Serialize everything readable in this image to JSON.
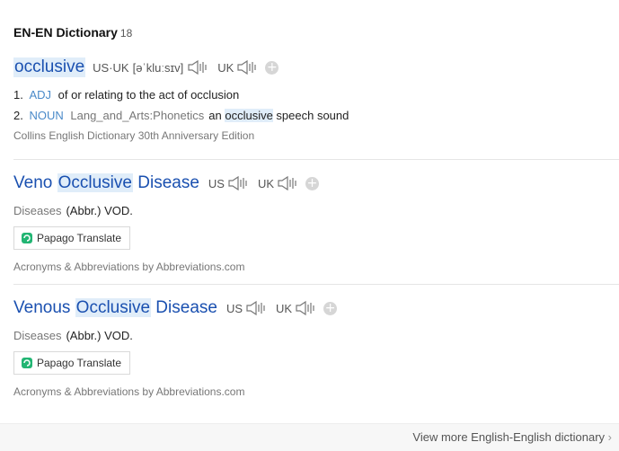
{
  "header": {
    "title": "EN-EN Dictionary",
    "count": "18"
  },
  "entries": [
    {
      "word": "occlusive",
      "phonetic_label": "US·UK",
      "phonetic": "[əˈkluːsɪv]",
      "uk_label": "UK",
      "meanings": [
        {
          "num": "1.",
          "pos": "ADJ",
          "text": "of or relating to the act of occlusion"
        },
        {
          "num": "2.",
          "pos": "NOUN",
          "field": "Lang_and_Arts:Phonetics",
          "pre": "an ",
          "hl": "occlusive",
          "post": " speech sound"
        }
      ],
      "source": "Collins English Dictionary 30th Anniversary Edition"
    },
    {
      "word_pre": "Veno ",
      "word_hl": "Occlusive",
      "word_post": " Disease",
      "us_label": "US",
      "uk_label": "UK",
      "category": "Diseases",
      "definition": "(Abbr.) VOD.",
      "translate_label": "Papago Translate",
      "source": "Acronyms & Abbreviations by Abbreviations.com"
    },
    {
      "word_pre": "Venous ",
      "word_hl": "Occlusive",
      "word_post": " Disease",
      "us_label": "US",
      "uk_label": "UK",
      "category": "Diseases",
      "definition": "(Abbr.) VOD.",
      "translate_label": "Papago Translate",
      "source": "Acronyms & Abbreviations by Abbreviations.com"
    }
  ],
  "footer": {
    "more_label": "View more English-English dictionary",
    "arrow": "›"
  }
}
